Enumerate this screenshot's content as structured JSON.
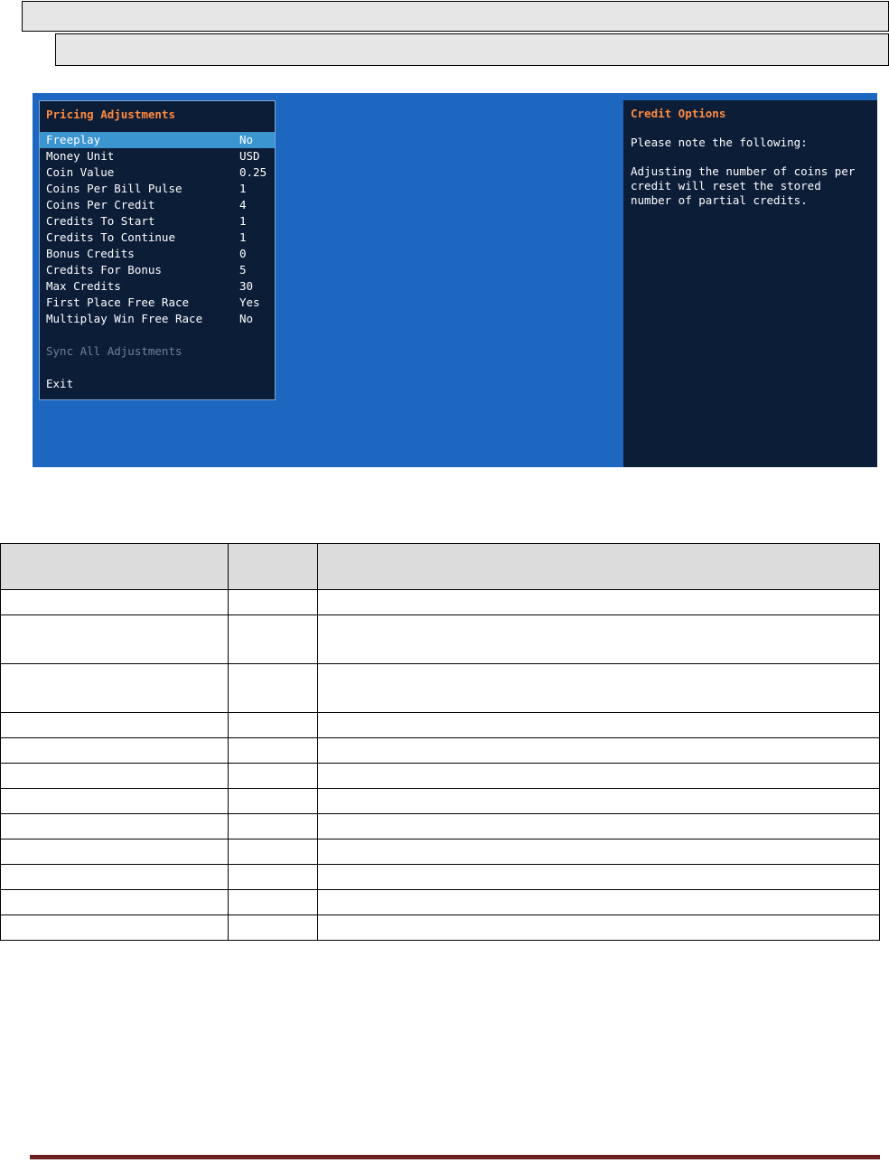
{
  "pricing_menu": {
    "title": "Pricing Adjustments",
    "items": [
      {
        "label": "Freeplay",
        "value": "No",
        "selected": true
      },
      {
        "label": "Money Unit",
        "value": "USD"
      },
      {
        "label": "Coin Value",
        "value": "0.25"
      },
      {
        "label": "Coins Per Bill Pulse",
        "value": "1"
      },
      {
        "label": "Coins Per Credit",
        "value": "4"
      },
      {
        "label": "Credits To Start",
        "value": "1"
      },
      {
        "label": "Credits To Continue",
        "value": "1"
      },
      {
        "label": "Bonus Credits",
        "value": "0"
      },
      {
        "label": "Credits For Bonus",
        "value": "5"
      },
      {
        "label": "Max Credits",
        "value": "30"
      },
      {
        "label": "First Place Free Race",
        "value": "Yes"
      },
      {
        "label": "Multiplay Win Free Race",
        "value": "No"
      }
    ],
    "sync_label": "Sync All Adjustments",
    "exit_label": "Exit"
  },
  "info_panel": {
    "title": "Credit Options",
    "text": "Please note the following:\n\nAdjusting the number of coins per credit will reset the stored number of partial credits."
  },
  "colors": {
    "screen_bg": "#1e67c1",
    "panel_bg": "#0c1d38",
    "title_accent": "#ff8a3c",
    "selection": "#3a95d1",
    "footer_rule": "#6b1f1f"
  }
}
